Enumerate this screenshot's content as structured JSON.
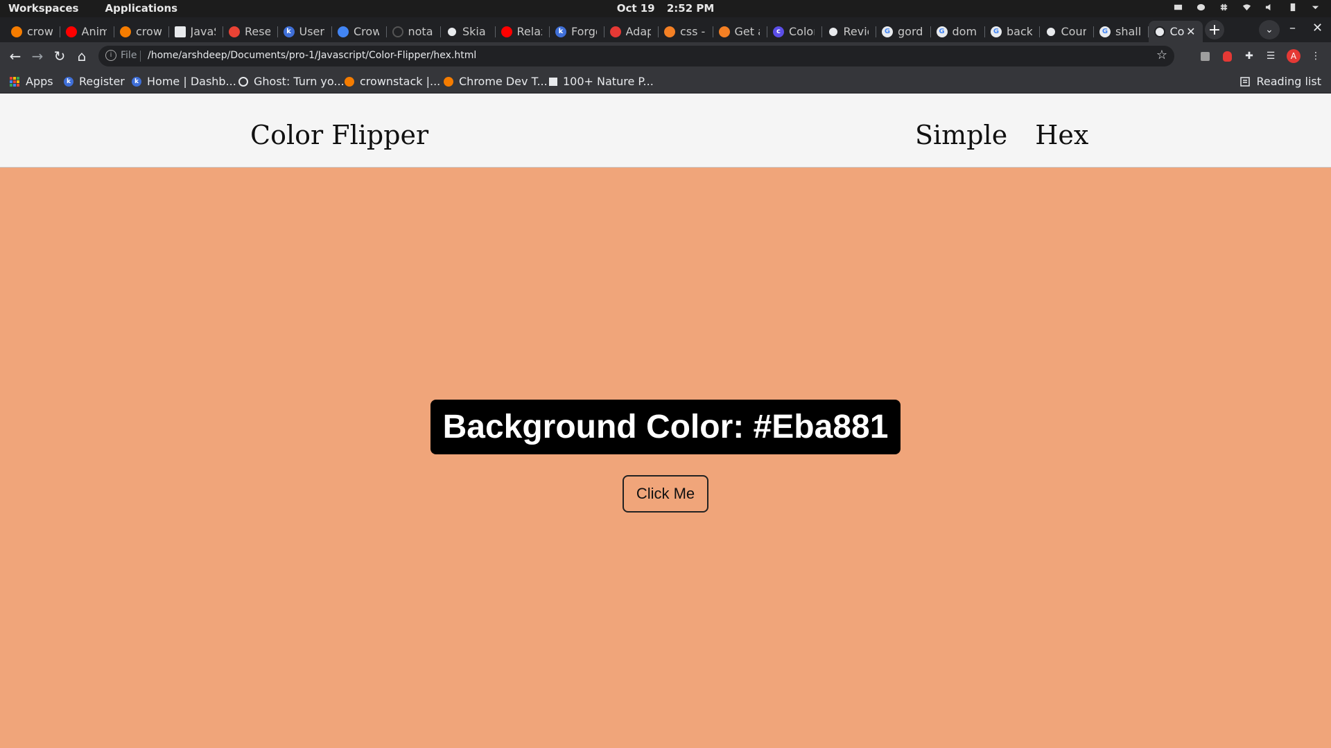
{
  "desktop": {
    "workspaces_label": "Workspaces",
    "applications_label": "Applications",
    "date": "Oct 19",
    "time": "2:52 PM"
  },
  "tabs": [
    {
      "title": "crown",
      "icon": "orange-circle-icon",
      "color": "#f57c00"
    },
    {
      "title": "Anim",
      "icon": "youtube-icon",
      "color": "#ff0000"
    },
    {
      "title": "crown",
      "icon": "orange-circle-icon",
      "color": "#f57c00"
    },
    {
      "title": "JavaS",
      "icon": "bookmark-square-icon",
      "color": "#ffffff"
    },
    {
      "title": "Reset",
      "icon": "gmail-icon",
      "color": "#ea4335"
    },
    {
      "title": "User-",
      "icon": "k-icon",
      "color": "#3f6fd8"
    },
    {
      "title": "Crow",
      "icon": "calendar-icon",
      "color": "#4285f4"
    },
    {
      "title": "notas",
      "icon": "github-icon",
      "color": "#333333"
    },
    {
      "title": "Skia",
      "icon": "globe-icon",
      "color": "#e8eaed"
    },
    {
      "title": "Relax",
      "icon": "youtube-icon",
      "color": "#ff0000"
    },
    {
      "title": "Forgo",
      "icon": "k-icon",
      "color": "#3f6fd8"
    },
    {
      "title": "Adap",
      "icon": "asterisk-icon",
      "color": "#e53935"
    },
    {
      "title": "css -",
      "icon": "stackoverflow-icon",
      "color": "#f48024"
    },
    {
      "title": "Get a",
      "icon": "stackoverflow-icon",
      "color": "#f48024"
    },
    {
      "title": "Color",
      "icon": "c-icon",
      "color": "#5b4ee8"
    },
    {
      "title": "Revie",
      "icon": "globe-icon",
      "color": "#e8eaed"
    },
    {
      "title": "gordo",
      "icon": "google-icon",
      "color": "#e8eaed"
    },
    {
      "title": "dom",
      "icon": "google-icon",
      "color": "#e8eaed"
    },
    {
      "title": "backg",
      "icon": "google-icon",
      "color": "#e8eaed"
    },
    {
      "title": "Coun",
      "icon": "globe-icon",
      "color": "#e8eaed"
    },
    {
      "title": "shall",
      "icon": "google-icon",
      "color": "#e8eaed"
    },
    {
      "title": "Co",
      "icon": "globe-icon",
      "color": "#e8eaed",
      "active": true
    }
  ],
  "toolbar": {
    "scheme": "File",
    "url": "/home/arshdeep/Documents/pro-1/Javascript/Color-Flipper/hex.html",
    "profile_initial": "A"
  },
  "bookmarks": [
    {
      "label": "Apps",
      "icon": "apps-grid-icon"
    },
    {
      "label": "Register",
      "icon": "k-icon",
      "color": "#3f6fd8"
    },
    {
      "label": "Home | Dashb...",
      "icon": "k-icon",
      "color": "#3f6fd8"
    },
    {
      "label": "Ghost: Turn yo...",
      "icon": "ghost-icon",
      "color": "#e8eaed"
    },
    {
      "label": "crownstack |...",
      "icon": "orange-circle-icon",
      "color": "#f57c00"
    },
    {
      "label": "Chrome Dev T...",
      "icon": "orange-circle-icon",
      "color": "#f57c00"
    },
    {
      "label": "100+ Nature P...",
      "icon": "unsplash-icon",
      "color": "#000000"
    }
  ],
  "reading_list_label": "Reading list",
  "page": {
    "brand": "Color Flipper",
    "nav": [
      "Simple",
      "Hex"
    ],
    "color_text": "Background Color: #Eba881",
    "button_label": "Click Me",
    "background_color": "#f0a57a"
  }
}
